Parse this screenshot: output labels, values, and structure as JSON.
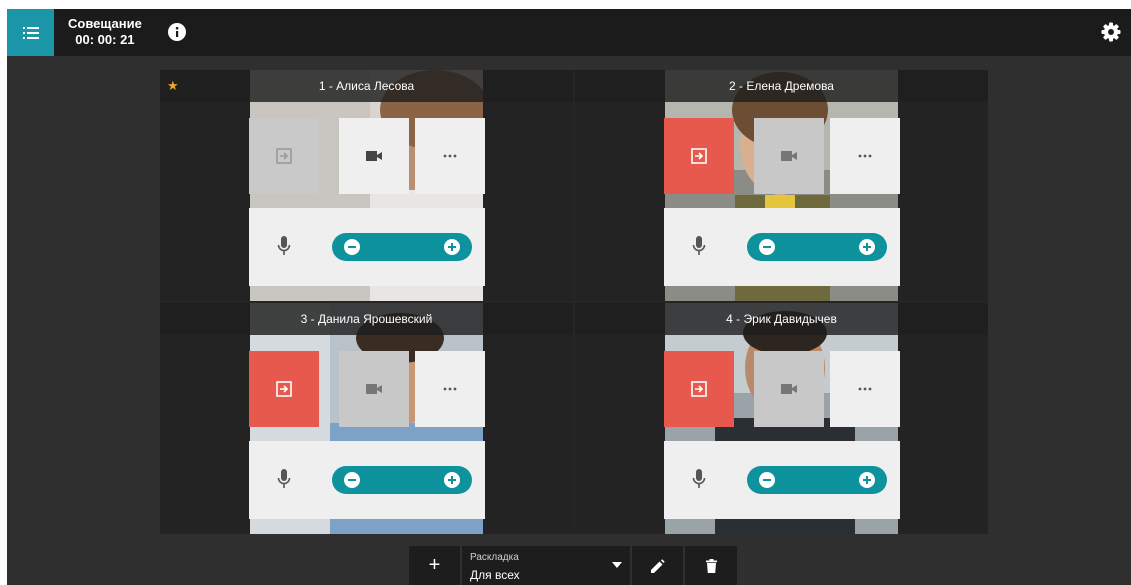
{
  "header": {
    "meeting_title": "Совещание",
    "timer": "00: 00: 21",
    "icons": [
      "list-menu-icon",
      "info-icon",
      "settings-icon"
    ],
    "accent_color": "#1b96a8"
  },
  "participants": [
    {
      "name": "1 - Алиса Лесова",
      "starred": true,
      "exit_state": "disabled",
      "video_state": "on"
    },
    {
      "name": "2 - Елена Дремова",
      "starred": false,
      "exit_state": "active",
      "video_state": "dim"
    },
    {
      "name": "3 - Данила Ярошевский",
      "starred": false,
      "exit_state": "active",
      "video_state": "dim"
    },
    {
      "name": "4 - Эрик Давидычев",
      "starred": false,
      "exit_state": "active",
      "video_state": "dim"
    }
  ],
  "colors": {
    "exit_active": "#e8594d",
    "volume_bar": "#0e929e",
    "star": "#f2a52b"
  },
  "toolbar": {
    "add_label": "+",
    "layout_label": "Раскладка",
    "layout_value": "Для всех"
  }
}
